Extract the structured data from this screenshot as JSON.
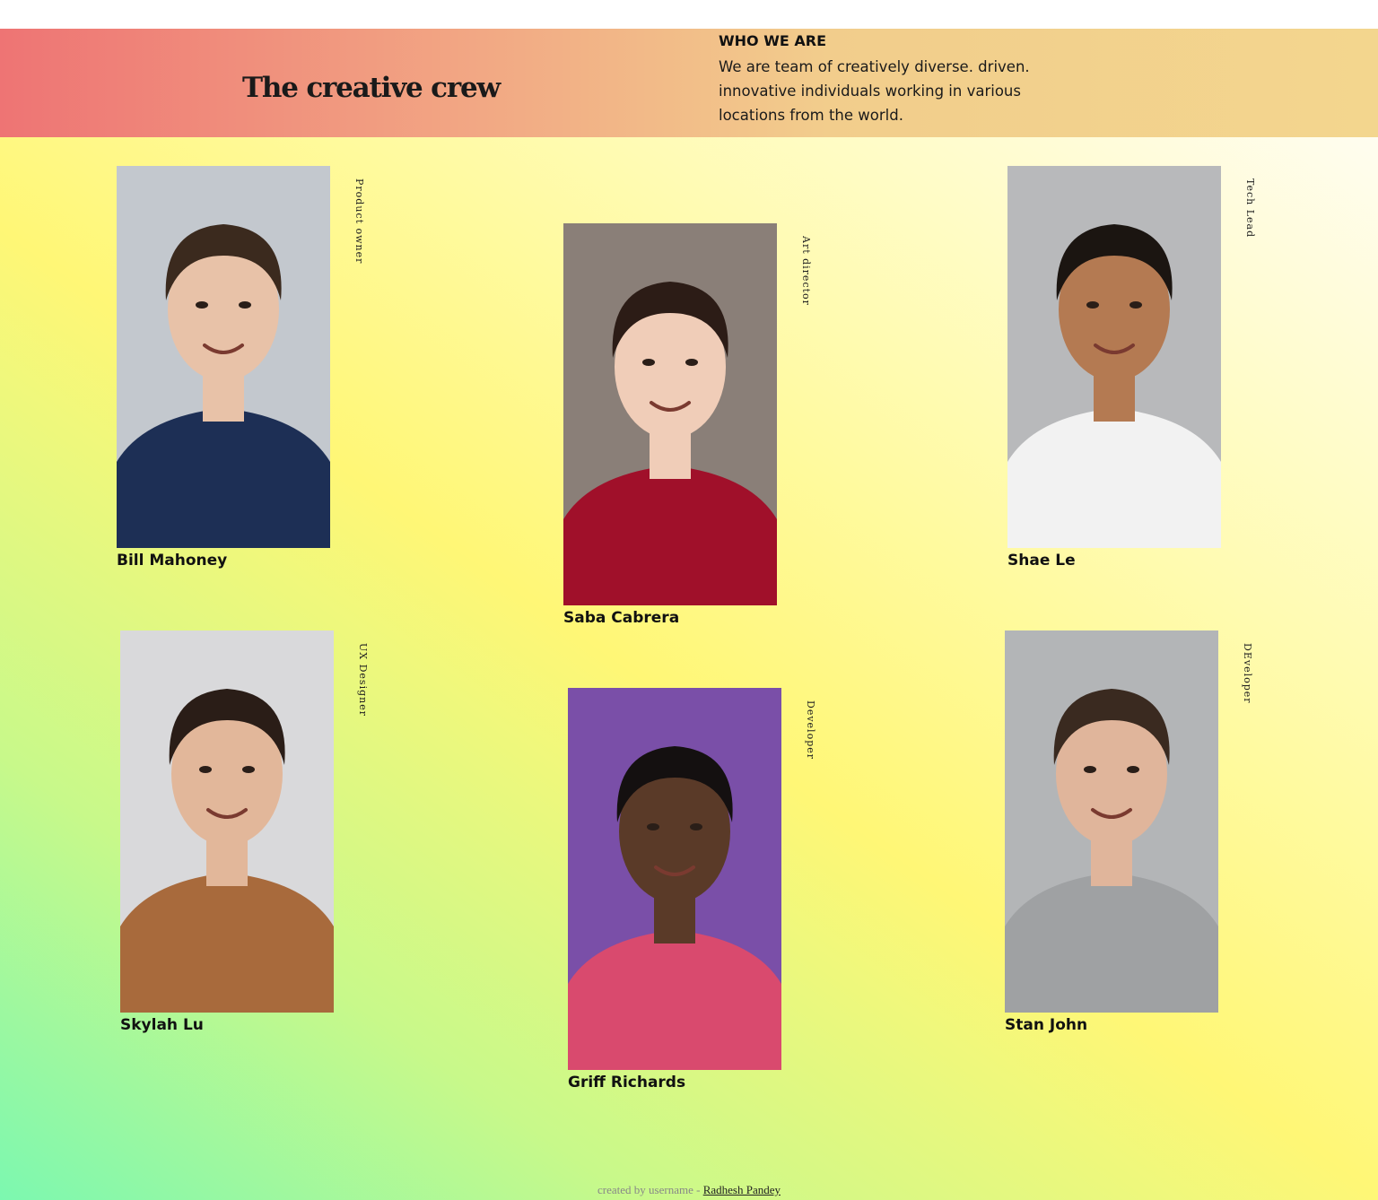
{
  "header": {
    "title": "The creative crew",
    "who_heading": "WHO WE ARE",
    "who_text": "We are team of creatively diverse. driven. innovative individuals working in various locations from the world."
  },
  "members": [
    {
      "name": "Bill Mahoney",
      "role": "Product owner",
      "bg": "#c3c8ce",
      "shirt": "#1d2f55",
      "skin": "#e8c2a8",
      "hair": "#3b2a1e"
    },
    {
      "name": "Saba Cabrera",
      "role": "Art director",
      "bg": "#8a7f78",
      "shirt": "#a0102a",
      "skin": "#f0cdb8",
      "hair": "#2c1c16"
    },
    {
      "name": "Shae Le",
      "role": "Tech Lead",
      "bg": "#b8b9bb",
      "shirt": "#f2f2f2",
      "skin": "#b47a52",
      "hair": "#1b1511"
    },
    {
      "name": "Skylah Lu",
      "role": "UX Designer",
      "bg": "#d9d9db",
      "shirt": "#a86a3c",
      "skin": "#e2b79a",
      "hair": "#2a1d17"
    },
    {
      "name": "Griff Richards",
      "role": "Developer",
      "bg": "#7a4fa8",
      "shirt": "#d94a6e",
      "skin": "#5a3a28",
      "hair": "#141010"
    },
    {
      "name": "Stan John",
      "role": "DEveloper",
      "bg": "#b3b5b7",
      "shirt": "#9fa1a3",
      "skin": "#e0b59b",
      "hair": "#3a2a20"
    }
  ],
  "footer": {
    "prefix": "created by username - ",
    "link_text": "Radhesh Pandey"
  }
}
